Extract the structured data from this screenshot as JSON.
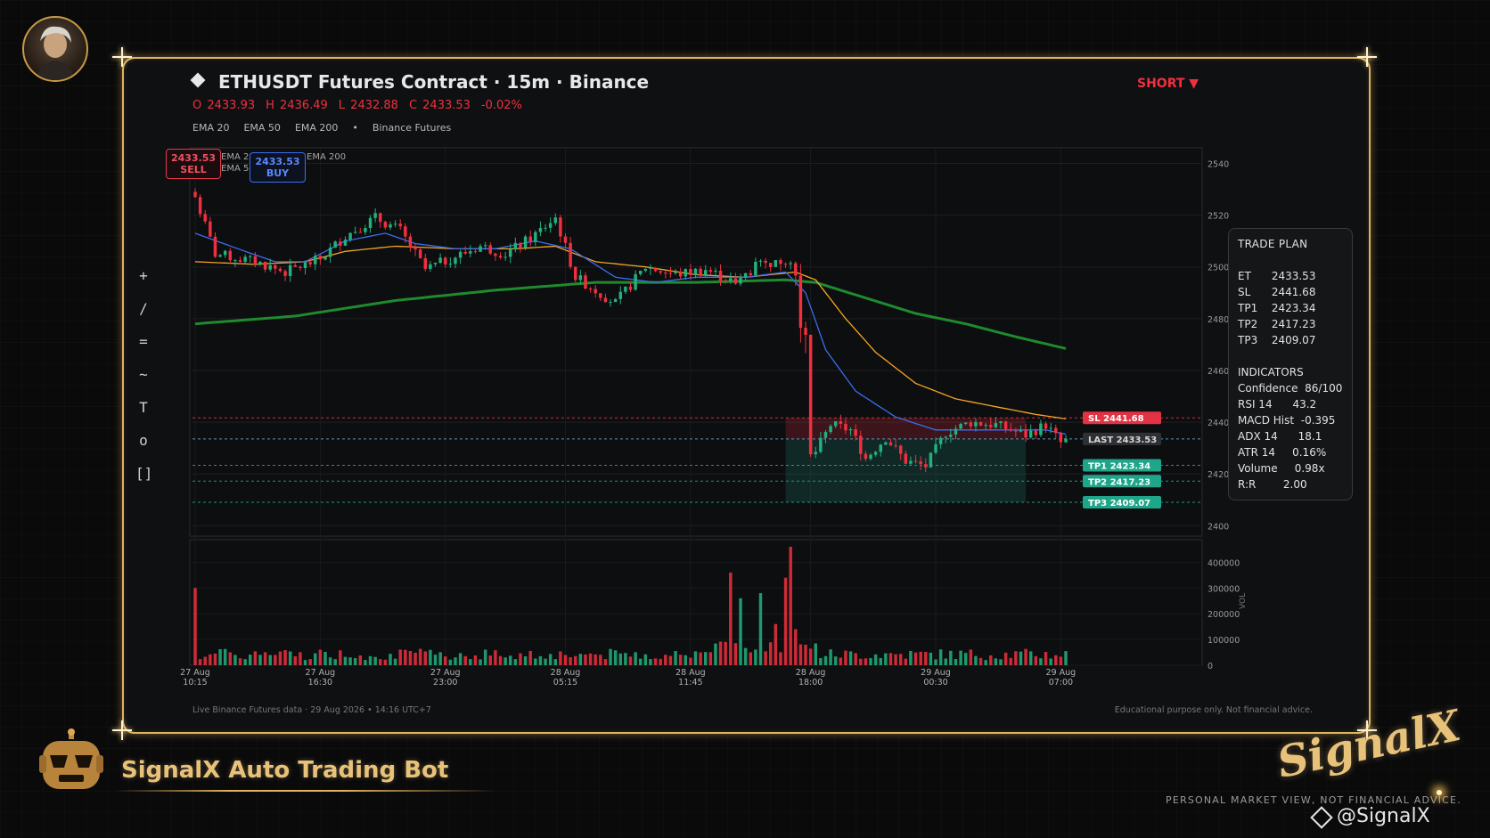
{
  "header": {
    "title": "ETHUSDT Futures Contract  ·  15m  ·  Binance",
    "ohlc": {
      "open": "O 2433.93",
      "high": "H 2436.49",
      "low": "L 2432.88",
      "close": "C 2433.53",
      "change": "-0.02%"
    },
    "legend": [
      "EMA 20",
      "EMA 50",
      "EMA 200",
      "•",
      "Binance Futures"
    ],
    "direction": "SHORT ▼"
  },
  "toolbar": [
    "+",
    "/",
    "=",
    "~",
    "T",
    "o",
    "[]"
  ],
  "badges": {
    "sell_price": "2433.53",
    "sell_label": "SELL",
    "buy_price": "2433.53",
    "buy_label": "BUY",
    "mini_legend": [
      "EMA 20",
      "EMA 50",
      "EMA 200"
    ]
  },
  "trade_plan": {
    "title": "TRADE PLAN",
    "levels": [
      {
        "k": "ET",
        "v": "2433.53"
      },
      {
        "k": "SL",
        "v": "2441.68"
      },
      {
        "k": "TP1",
        "v": "2423.34"
      },
      {
        "k": "TP2",
        "v": "2417.23"
      },
      {
        "k": "TP3",
        "v": "2409.07"
      }
    ],
    "indicators_title": "INDICATORS",
    "indicators": [
      {
        "k": "Confidence",
        "v": "86/100"
      },
      {
        "k": "RSI 14",
        "v": "43.2"
      },
      {
        "k": "MACD Hist",
        "v": "-0.395"
      },
      {
        "k": "ADX 14",
        "v": "18.1"
      },
      {
        "k": "ATR 14",
        "v": "0.16%"
      },
      {
        "k": "Volume",
        "v": "0.98x"
      },
      {
        "k": "R:R",
        "v": "2.00"
      }
    ]
  },
  "footer": {
    "left": "Live Binance Futures data  ·  29 Aug 2026 • 14:16 UTC+7",
    "right": "Educational purpose only. Not financial advice."
  },
  "branding": {
    "bot_title": "SignalX Auto Trading Bot",
    "logo": "SignalX",
    "subtitle": "PERSONAL MARKET VIEW, NOT FINANCIAL ADVICE.",
    "handle": "@SignalX"
  },
  "colors": {
    "up": "#22b07d",
    "down": "#f0303e",
    "ema20": "#3b6df0",
    "ema50": "#f5a623",
    "ema200": "#1f8a2e",
    "accent_gold": "#e0b35e",
    "tp": "#1fa58a",
    "sl": "#e23344"
  },
  "chart_data": {
    "type": "candlestick",
    "x_ticks": [
      {
        "date": "27 Aug",
        "time": "10:15"
      },
      {
        "date": "27 Aug",
        "time": "16:30"
      },
      {
        "date": "27 Aug",
        "time": "23:00"
      },
      {
        "date": "28 Aug",
        "time": "05:15"
      },
      {
        "date": "28 Aug",
        "time": "11:45"
      },
      {
        "date": "28 Aug",
        "time": "18:00"
      },
      {
        "date": "29 Aug",
        "time": "00:30"
      },
      {
        "date": "29 Aug",
        "time": "07:00"
      }
    ],
    "x_tick_index": [
      0,
      25,
      50,
      74,
      99,
      123,
      148,
      173
    ],
    "bar_count": 175,
    "y_ticks": [
      2400,
      2420,
      2440,
      2460,
      2480,
      2500,
      2520,
      2540
    ],
    "ylim": [
      2396,
      2546
    ],
    "vol_ticks": [
      0,
      100000,
      200000,
      300000,
      400000
    ],
    "vol_ylabel": "VOL",
    "vol_max": 460000,
    "close_path": [
      [
        0,
        2527
      ],
      [
        4,
        2505
      ],
      [
        12,
        2502
      ],
      [
        18,
        2498
      ],
      [
        25,
        2503
      ],
      [
        30,
        2512
      ],
      [
        36,
        2519
      ],
      [
        41,
        2514
      ],
      [
        46,
        2499
      ],
      [
        52,
        2504
      ],
      [
        57,
        2508
      ],
      [
        62,
        2505
      ],
      [
        67,
        2511
      ],
      [
        72,
        2519
      ],
      [
        76,
        2496
      ],
      [
        84,
        2486
      ],
      [
        90,
        2500
      ],
      [
        96,
        2497
      ],
      [
        102,
        2499
      ],
      [
        108,
        2494
      ],
      [
        112,
        2500
      ],
      [
        118,
        2503
      ],
      [
        120,
        2497
      ],
      [
        122,
        2468
      ],
      [
        123,
        2425
      ],
      [
        127,
        2439
      ],
      [
        131,
        2437
      ],
      [
        134,
        2426
      ],
      [
        138,
        2434
      ],
      [
        142,
        2425
      ],
      [
        146,
        2423
      ],
      [
        150,
        2436
      ],
      [
        155,
        2440
      ],
      [
        160,
        2439
      ],
      [
        166,
        2435
      ],
      [
        170,
        2439
      ],
      [
        173,
        2432
      ],
      [
        175,
        2433.5
      ]
    ],
    "ema20_path": [
      [
        0,
        2513
      ],
      [
        10,
        2506
      ],
      [
        16,
        2502
      ],
      [
        22,
        2502
      ],
      [
        30,
        2510
      ],
      [
        38,
        2513
      ],
      [
        44,
        2509
      ],
      [
        52,
        2507
      ],
      [
        60,
        2507
      ],
      [
        68,
        2510
      ],
      [
        75,
        2507
      ],
      [
        84,
        2496
      ],
      [
        92,
        2494
      ],
      [
        100,
        2496
      ],
      [
        110,
        2496
      ],
      [
        118,
        2498
      ],
      [
        122,
        2490
      ],
      [
        126,
        2468
      ],
      [
        132,
        2452
      ],
      [
        140,
        2442
      ],
      [
        148,
        2437
      ],
      [
        156,
        2437
      ],
      [
        164,
        2437
      ],
      [
        170,
        2437
      ],
      [
        175,
        2435
      ]
    ],
    "ema50_path": [
      [
        0,
        2502
      ],
      [
        12,
        2501
      ],
      [
        22,
        2502
      ],
      [
        30,
        2506
      ],
      [
        40,
        2508
      ],
      [
        52,
        2507
      ],
      [
        64,
        2507
      ],
      [
        72,
        2508
      ],
      [
        80,
        2502
      ],
      [
        90,
        2500
      ],
      [
        100,
        2497
      ],
      [
        110,
        2496
      ],
      [
        120,
        2498
      ],
      [
        124,
        2495
      ],
      [
        130,
        2480
      ],
      [
        136,
        2467
      ],
      [
        144,
        2455
      ],
      [
        152,
        2449
      ],
      [
        160,
        2446
      ],
      [
        168,
        2443
      ],
      [
        175,
        2441
      ]
    ],
    "ema200_path": [
      [
        0,
        2478
      ],
      [
        20,
        2481
      ],
      [
        40,
        2487
      ],
      [
        60,
        2491
      ],
      [
        80,
        2494
      ],
      [
        100,
        2494
      ],
      [
        118,
        2495
      ],
      [
        124,
        2494
      ],
      [
        134,
        2488
      ],
      [
        144,
        2482
      ],
      [
        154,
        2478
      ],
      [
        164,
        2473
      ],
      [
        175,
        2468
      ]
    ],
    "volume_spikes": [
      {
        "i": 0,
        "v": 300000,
        "dir": "down"
      },
      {
        "i": 107,
        "v": 360000,
        "dir": "down"
      },
      {
        "i": 109,
        "v": 260000,
        "dir": "up"
      },
      {
        "i": 113,
        "v": 280000,
        "dir": "up"
      },
      {
        "i": 116,
        "v": 160000,
        "dir": "down"
      },
      {
        "i": 118,
        "v": 340000,
        "dir": "down"
      },
      {
        "i": 119,
        "v": 460000,
        "dir": "down"
      },
      {
        "i": 120,
        "v": 140000,
        "dir": "down"
      }
    ],
    "levels": {
      "sl": {
        "label": "SL  2441.68",
        "value": 2441.68
      },
      "last": {
        "label": "LAST  2433.53",
        "value": 2433.53
      },
      "tp1": {
        "label": "TP1  2423.34",
        "value": 2423.34
      },
      "tp2": {
        "label": "TP2  2417.23",
        "value": 2417.23
      },
      "tp3": {
        "label": "TP3  2409.07",
        "value": 2409.07
      }
    },
    "position_box": {
      "start_index": 118,
      "end_index": 166
    }
  }
}
